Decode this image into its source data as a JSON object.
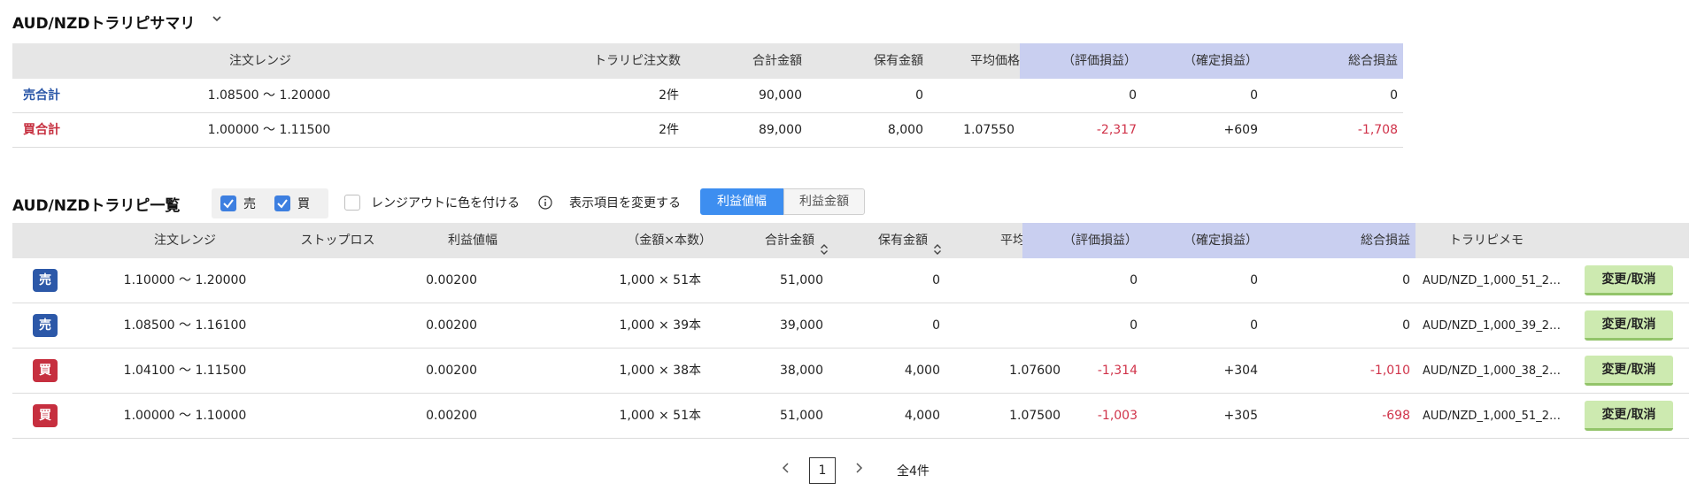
{
  "summary": {
    "title": "AUD/NZDトラリピサマリ",
    "headers": {
      "range": "注文レンジ",
      "orders": "トラリピ注文数",
      "total": "合計金額",
      "holding": "保有金額",
      "avg": "平均価格",
      "unrealized": "（評価損益）",
      "realized": "（確定損益）",
      "pl_total": "総合損益"
    },
    "rows": [
      {
        "label": "売合計",
        "range": "1.08500 〜 1.20000",
        "orders": "2件",
        "total": "90,000",
        "holding": "0",
        "avg": "",
        "unrealized": "0",
        "realized": "0",
        "pl_total": "0"
      },
      {
        "label": "買合計",
        "range": "1.00000 〜 1.11500",
        "orders": "2件",
        "total": "89,000",
        "holding": "8,000",
        "avg": "1.07550",
        "unrealized": "-2,317",
        "realized": "+609",
        "pl_total": "-1,708"
      }
    ]
  },
  "list": {
    "title": "AUD/NZDトラリピ一覧",
    "filters": {
      "sell_label": "売",
      "sell_checked": true,
      "buy_label": "買",
      "buy_checked": true,
      "range_out_label": "レンジアウトに色を付ける",
      "range_out_checked": false
    },
    "display_label": "表示項目を変更する",
    "toggle": {
      "active": "利益値幅",
      "inactive": "利益金額"
    },
    "headers": {
      "range": "注文レンジ",
      "stoploss": "ストップロス",
      "profit_width": "利益値幅",
      "amount": "（金額×本数）",
      "total": "合計金額",
      "holding": "保有金額",
      "avg": "平均価格",
      "unrealized": "（評価損益）",
      "realized": "（確定損益）",
      "pl_total": "総合損益",
      "memo": "トラリピメモ"
    },
    "rows": [
      {
        "side": "売",
        "range": "1.10000 〜 1.20000",
        "stoploss": "",
        "profit_width": "0.00200",
        "amount": "1,000 × 51本",
        "total": "51,000",
        "holding": "0",
        "avg": "",
        "unrealized": "0",
        "realized": "0",
        "pl_total": "0",
        "memo": "AUD/NZD_1,000_51_2…",
        "action": "変更/取消"
      },
      {
        "side": "売",
        "range": "1.08500 〜 1.16100",
        "stoploss": "",
        "profit_width": "0.00200",
        "amount": "1,000 × 39本",
        "total": "39,000",
        "holding": "0",
        "avg": "",
        "unrealized": "0",
        "realized": "0",
        "pl_total": "0",
        "memo": "AUD/NZD_1,000_39_2…",
        "action": "変更/取消"
      },
      {
        "side": "買",
        "range": "1.04100 〜 1.11500",
        "stoploss": "",
        "profit_width": "0.00200",
        "amount": "1,000 × 38本",
        "total": "38,000",
        "holding": "4,000",
        "avg": "1.07600",
        "unrealized": "-1,314",
        "realized": "+304",
        "pl_total": "-1,010",
        "memo": "AUD/NZD_1,000_38_2…",
        "action": "変更/取消"
      },
      {
        "side": "買",
        "range": "1.00000 〜 1.10000",
        "stoploss": "",
        "profit_width": "0.00200",
        "amount": "1,000 × 51本",
        "total": "51,000",
        "holding": "4,000",
        "avg": "1.07500",
        "unrealized": "-1,003",
        "realized": "+305",
        "pl_total": "-698",
        "memo": "AUD/NZD_1,000_51_2…",
        "action": "変更/取消"
      }
    ]
  },
  "pagination": {
    "current": "1",
    "total_label": "全4件"
  },
  "colors": {
    "negative": "#d0334a",
    "sell": "#2c58a8",
    "buy": "#c62f3f",
    "pl_header": "#c9cff0",
    "accent": "#3d8ef0",
    "action_button": "#cdeab0"
  }
}
